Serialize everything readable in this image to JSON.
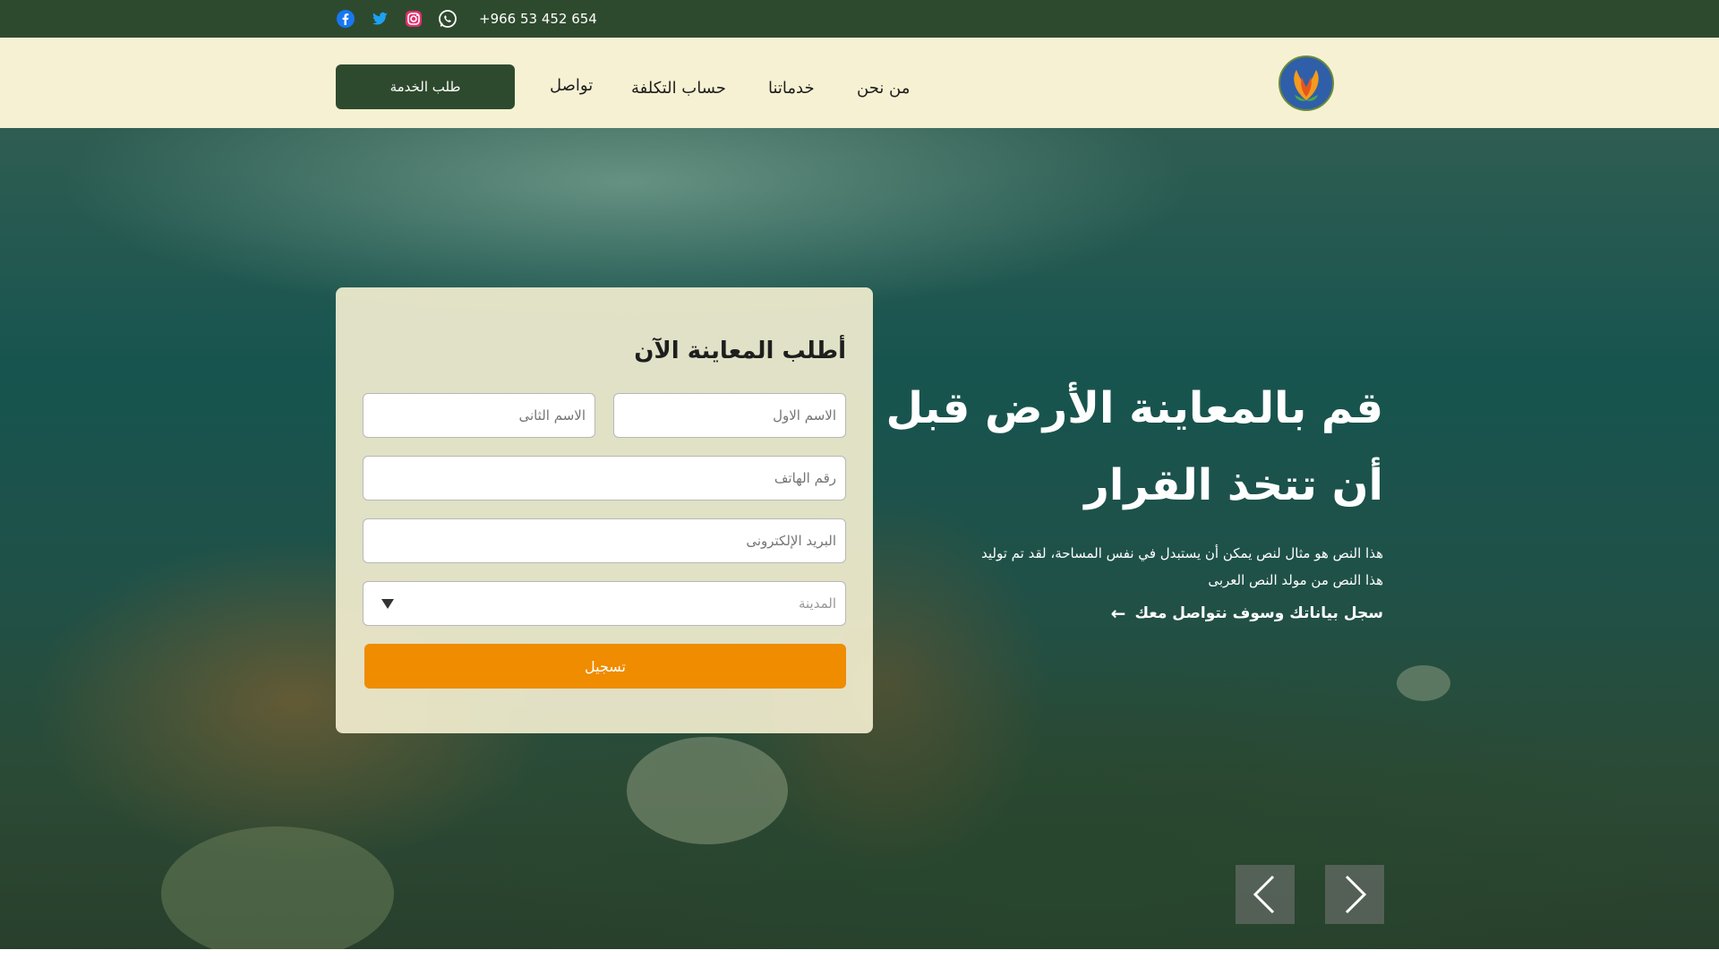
{
  "topbar": {
    "phone": "+966 53 452 654",
    "social": [
      {
        "name": "facebook-icon",
        "color": "#1877f2"
      },
      {
        "name": "twitter-icon",
        "color": "#1da1f2"
      },
      {
        "name": "instagram-icon",
        "color": "#e1306c"
      },
      {
        "name": "whatsapp-icon",
        "color": "#25d366"
      }
    ]
  },
  "header": {
    "nav": {
      "about": "من نحن",
      "services": "خدماتنا",
      "cost": "حساب التكلفة",
      "contact": "تواصل"
    },
    "service_button": "طلب الخدمة"
  },
  "hero": {
    "headline_line1": "قم بالمعاينة الأرض قبل",
    "headline_line2": "أن تتخذ القرار",
    "description_line1": "هذا النص هو مثال لنص يمكن أن يستبدل في نفس المساحة، لقد تم توليد",
    "description_line2": "هذا النص من مولد النص العربى",
    "cta": "سجل بياناتك وسوف نتواصل معك"
  },
  "form": {
    "title": "أطلب المعاينة الآن",
    "first_name_placeholder": "الاسم الاول",
    "last_name_placeholder": "الاسم الثانى",
    "phone_placeholder": "رقم الهاتف",
    "email_placeholder": "البريد الإلكترونى",
    "city_placeholder": "المدينة",
    "submit": "تسجيل"
  },
  "colors": {
    "topbar": "#2e4a2e",
    "header": "#f6f1d3",
    "accent": "#ef8c00"
  }
}
